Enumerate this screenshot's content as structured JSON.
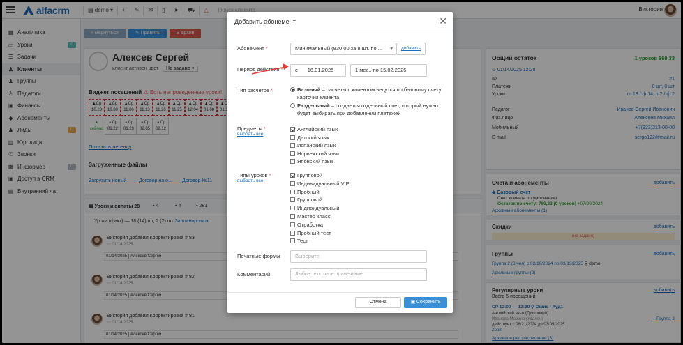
{
  "app": {
    "logo_text": "alfacrm",
    "topbar": {
      "branch": "demo",
      "search_placeholder": "Поиск клиента",
      "user_name": "Виктория"
    }
  },
  "sidebar": {
    "items": [
      {
        "label": "Аналитика",
        "icon": "chart-icon"
      },
      {
        "label": "Уроки",
        "icon": "calendar-icon",
        "badge": "0",
        "badge_color": "#5bc0be"
      },
      {
        "label": "Задачи",
        "icon": "tasks-icon"
      },
      {
        "label": "Клиенты",
        "icon": "user-icon",
        "active": true
      },
      {
        "label": "Группы",
        "icon": "group-icon"
      },
      {
        "label": "Педагоги",
        "icon": "teacher-icon"
      },
      {
        "label": "Финансы",
        "icon": "finance-icon"
      },
      {
        "label": "Абонементы",
        "icon": "subscription-icon"
      },
      {
        "label": "Лиды",
        "icon": "leads-icon",
        "badge": "11",
        "badge_color": "#f0ad4e"
      },
      {
        "label": "Юр. лица",
        "icon": "legal-icon"
      },
      {
        "label": "Звонки",
        "icon": "phone-icon"
      },
      {
        "label": "Информер",
        "icon": "informer-icon",
        "badge": "11",
        "badge_color": "#b0b6bf"
      },
      {
        "label": "Доступ в CRM",
        "icon": "lock-icon"
      },
      {
        "label": "Внутренний чат",
        "icon": "chat-icon"
      }
    ]
  },
  "client": {
    "name": "Алексев Сергей",
    "tags": "клиент  активен  цвет",
    "status_select": "Не задано",
    "buttons": {
      "back": "« Вернуться",
      "edit": "✎ Править",
      "archive": "В архив"
    },
    "widget_title": "Виджет посещений",
    "widget_warning": "Есть непроведенные уроки!",
    "show_legend": "Показать легенду",
    "dates": [
      {
        "d": "Ср",
        "t": "10.23"
      },
      {
        "d": "Ср",
        "t": "10.30"
      },
      {
        "d": "Ср",
        "t": "11.06"
      },
      {
        "d": "Ср",
        "t": "11.13"
      },
      {
        "d": "Ср",
        "t": "11.20"
      },
      {
        "d": "Ср",
        "t": "11.25"
      },
      {
        "d": "Ср",
        "t": "12.04"
      },
      {
        "d": "Ср",
        "t": "01.08"
      },
      {
        "d": "Ср",
        "t": "01.15"
      },
      {
        "d": "",
        "t": "сейчас"
      },
      {
        "d": "Ср",
        "t": "01.22"
      },
      {
        "d": "Ср",
        "t": "01.29"
      },
      {
        "d": "Ср",
        "t": "02.05"
      },
      {
        "d": "Ср",
        "t": "02.12"
      }
    ],
    "files_title": "Загруженные файлы",
    "files": [
      "Загрузить новый",
      "Договор на о...",
      "Договор №11"
    ],
    "tabs": [
      "Уроки и оплаты 28",
      "4",
      "4",
      "281"
    ],
    "lessons_line": "Уроки (факт) — 18 (14) шт, 2 (2) шт",
    "plan_link": "Запланировать",
    "feed": [
      {
        "author": "Виктория",
        "action": "добавил Корректировка # 83",
        "date": "01/14/2025",
        "row": "01/14/2025 | Алексев Сергей"
      },
      {
        "author": "Виктория",
        "action": "добавил Корректировка # 82",
        "date": "01/14/2025",
        "row": "01/14/2025 | Алексев Сергей"
      },
      {
        "author": "Виктория",
        "action": "добавил Корректировка # 81",
        "date": "01/14/2025",
        "row": "01/14/2025 | Алексев Сергей"
      }
    ]
  },
  "right_panel": {
    "balance_title": "Общий остаток",
    "balance_value": "1 уроков  869,33",
    "date_link": "01/14/2025 12:28",
    "rows": [
      {
        "k": "ID",
        "v": "#1"
      },
      {
        "k": "Платежи",
        "v": "8 шт, 0 шт"
      },
      {
        "k": "Уроки",
        "v": "гл 18 / ф 14, п 2 / ф 2"
      },
      {
        "k": "Педагог",
        "v": "Иванов Сергей Иванович"
      },
      {
        "k": "Физ.лицо",
        "v": "Алексеев Михаил"
      },
      {
        "k": "Мобильный",
        "v": "+7(923)213-00-00"
      },
      {
        "k": "E-mail",
        "v": "sergo122@mail.ru"
      }
    ],
    "add_label": "добавить",
    "subs_title": "Счета и абонементы",
    "base_account": "Базовый счет",
    "account_default": "Счет клиента по умолчанию",
    "balance_line": "Остаток по счету: 769,33 (0 уроков)",
    "balance_date": "+07/29/2024",
    "archive_subs": "Архивные абонементы (1)",
    "discounts_title": "Скидки",
    "discounts_empty": "(не задано)",
    "groups_title": "Группы",
    "group_line": "Группа 2 (3 чел) с 02/16/2024 по 03/13/2025",
    "group_branch": "demo",
    "archive_groups": "Архивные группы (2)",
    "regular_title": "Регулярные уроки",
    "regular_count": "Всего 5 посещений",
    "regular_line": "СР 12:00 — 12:30",
    "regular_place": "Офис / Ауд1",
    "regular_lines": [
      "Английский язык (Групповой)",
      "Иванова Марина (Удален)",
      "действует с 08/21/2024 до 03/05/2025",
      "Zoom"
    ],
    "regular_group_link": "Группа 2",
    "archive_regular": "Архивное рег. расписание (3)"
  },
  "modal": {
    "title": "Добавить абонемент",
    "subscription_label": "Абонемент",
    "subscription_value": "Минимальный (830,00 за 8 шт. по ...",
    "add_link": "добавить",
    "period_label": "Период действия",
    "period_from_prefix": "с",
    "period_from": "16.01.2025",
    "period_to": "1 мес., по 15.02.2025",
    "calc_label": "Тип расчетов",
    "calc_base_bold": "Базовый",
    "calc_base_text": " – расчеты с клиентом ведутся по базовому счету карточки клиента",
    "calc_split_bold": "Раздельный",
    "calc_split_text": " – создается отдельный счет, который нужно будет выбирать при добавлении платежей",
    "subjects_label": "Предметы",
    "select_all": "выбрать все",
    "subjects": [
      {
        "label": "Английский язык",
        "checked": true
      },
      {
        "label": "Датский язык",
        "checked": false
      },
      {
        "label": "Испанский язык",
        "checked": false
      },
      {
        "label": "Норвежский язык",
        "checked": false
      },
      {
        "label": "Японский язык",
        "checked": false
      }
    ],
    "lesson_types_label": "Типы уроков",
    "lesson_types": [
      {
        "label": "Групповой",
        "checked": true
      },
      {
        "label": "Индивидуальный VIP",
        "checked": false
      },
      {
        "label": "Пробный",
        "checked": false
      },
      {
        "label": "Групповой",
        "checked": false
      },
      {
        "label": "Индивидуальный",
        "checked": false
      },
      {
        "label": "Мастер класс",
        "checked": false
      },
      {
        "label": "Отработка",
        "checked": false
      },
      {
        "label": "Пробный тест",
        "checked": false
      },
      {
        "label": "Тест",
        "checked": false
      }
    ],
    "print_label": "Печатные формы",
    "print_placeholder": "Выберите",
    "comment_label": "Комментарий",
    "comment_placeholder": "Любое текстовое примечание",
    "cancel_label": "Отмена",
    "save_label": "Сохранить"
  },
  "colors": {
    "accent": "#1f6fb8",
    "save": "#3b8fd6",
    "danger": "#d9534f",
    "success": "#2a9d2a"
  }
}
